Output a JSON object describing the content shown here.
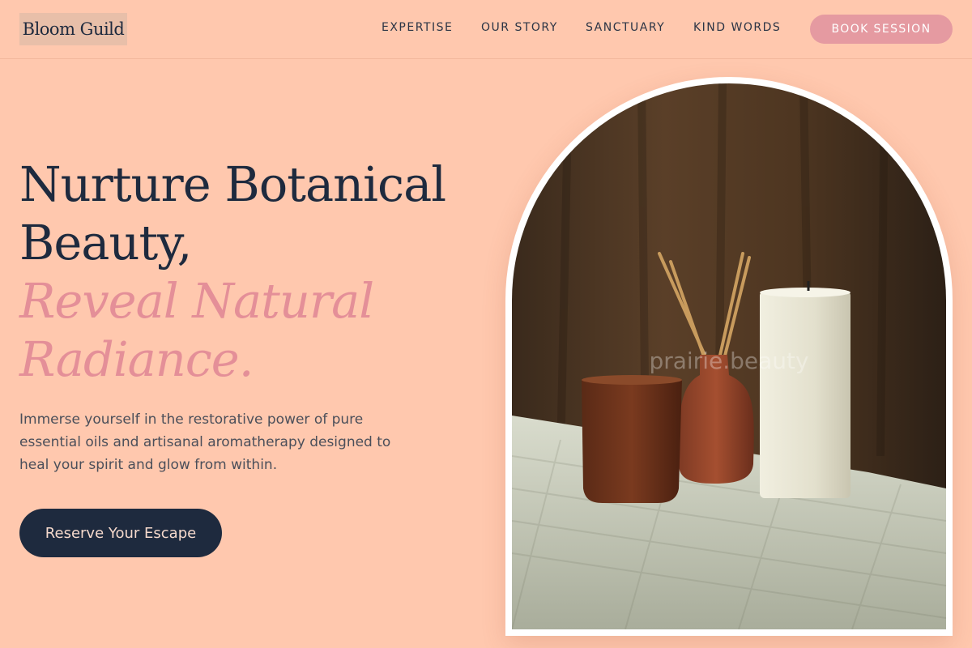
{
  "brand": {
    "logo_text": "Bloom Guild"
  },
  "nav": {
    "items": [
      {
        "label": "EXPERTISE"
      },
      {
        "label": "OUR STORY"
      },
      {
        "label": "SANCTUARY"
      },
      {
        "label": "KIND WORDS"
      }
    ],
    "book_label": "BOOK SESSION"
  },
  "hero": {
    "headline_line1": "Nurture Botanical",
    "headline_line2": "Beauty,",
    "accent_line1": "Reveal Natural",
    "accent_line2": "Radiance.",
    "description": "Immerse yourself in the restorative power of pure essential oils and artisanal aromatherapy designed to heal your spirit and glow from within.",
    "cta_label": "Reserve Your Escape"
  },
  "photo": {
    "watermark": "prairie.beauty"
  },
  "colors": {
    "background": "#ffc8ae",
    "navy": "#1e2a3e",
    "accent_pink": "#e48f98",
    "button_pink": "#e59aa1",
    "logo_bg": "#e8bfa9"
  }
}
